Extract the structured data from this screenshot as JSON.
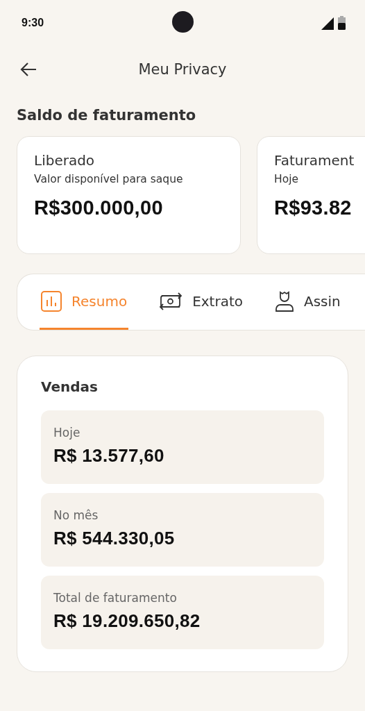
{
  "status_bar": {
    "time": "9:30"
  },
  "header": {
    "title": "Meu Privacy"
  },
  "section_title": "Saldo de faturamento",
  "balance_cards": [
    {
      "label": "Liberado",
      "subtitle": "Valor disponível para saque",
      "amount": "R$300.000,00"
    },
    {
      "label": "Faturament",
      "subtitle": "Hoje",
      "amount": "R$93.82"
    }
  ],
  "tabs": [
    {
      "label": "Resumo",
      "kind": "chart",
      "selected": true
    },
    {
      "label": "Extrato",
      "kind": "cash",
      "selected": false
    },
    {
      "label": "Assin",
      "kind": "person",
      "selected": false
    }
  ],
  "sales": {
    "title": "Vendas",
    "items": [
      {
        "label": "Hoje",
        "value": "R$ 13.577,60"
      },
      {
        "label": "No mês",
        "value": "R$ 544.330,05"
      },
      {
        "label": "Total de faturamento",
        "value": "R$ 19.209.650,82"
      }
    ]
  }
}
